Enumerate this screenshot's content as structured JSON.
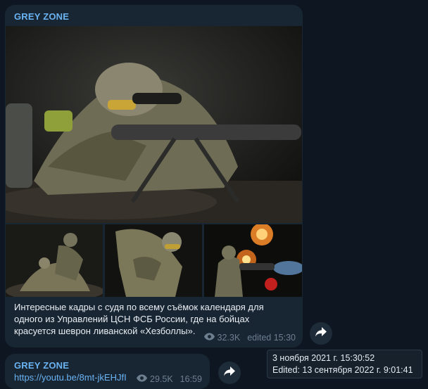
{
  "post1": {
    "channel": "GREY ZONE",
    "caption": "Интересные кадры с судя по всему съёмок календаря для\nодного из Управлений ЦСН ФСБ России, где на бойцах\nкрасуется шеврон ливанской «Хезболлы».",
    "views": "32.3K",
    "edited": "edited 15:30",
    "photos": [
      "sniper-main-photo",
      "soldiers-photo-1",
      "soldier-photo-2",
      "minigun-photo-3"
    ]
  },
  "post2": {
    "channel": "GREY ZONE",
    "link": "https://youtu.be/8mt-jkEHJfI",
    "views": "29.5K",
    "time": "16:59"
  },
  "tooltip": {
    "date": "3 ноября 2021 г. 15:30:52",
    "edited": "Edited: 13 сентября 2022 г. 9:01:41"
  },
  "icons": {
    "views": "eye-icon",
    "share": "share-arrow-icon"
  },
  "colors": {
    "background": "#0e1621",
    "bubble": "#182533",
    "accent": "#6ab3f3",
    "meta": "#6d7f8f"
  }
}
